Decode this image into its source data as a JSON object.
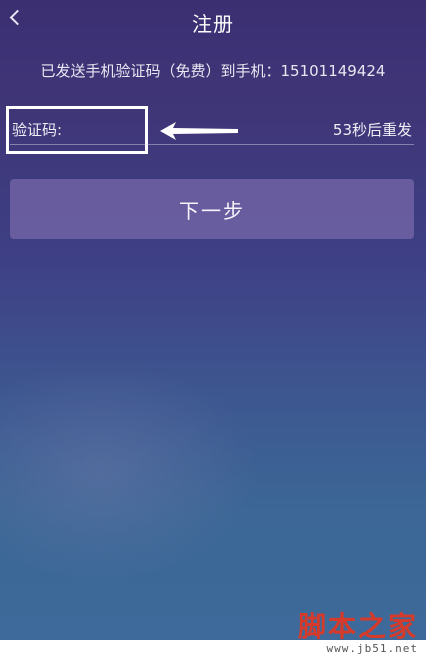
{
  "header": {
    "title": "注册",
    "back_icon": "chevron-left-icon"
  },
  "message": {
    "sent_text": "已发送手机验证码（免费）到手机：15101149424"
  },
  "code_field": {
    "label": "验证码:",
    "value": "",
    "resend_text": "53秒后重发"
  },
  "actions": {
    "next_label": "下一步"
  },
  "watermark": {
    "logo_text": "脚本之家",
    "url_text": "www.jb51.net"
  },
  "colors": {
    "background_top": "#3b2f72",
    "background_bottom": "#3d6a9a",
    "button": "#786aaa",
    "watermark_red": "#d63a2a"
  }
}
